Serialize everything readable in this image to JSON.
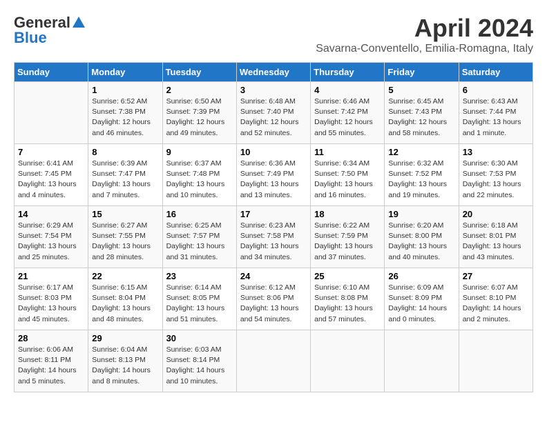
{
  "header": {
    "logo_general": "General",
    "logo_blue": "Blue",
    "month": "April 2024",
    "location": "Savarna-Conventello, Emilia-Romagna, Italy"
  },
  "days_of_week": [
    "Sunday",
    "Monday",
    "Tuesday",
    "Wednesday",
    "Thursday",
    "Friday",
    "Saturday"
  ],
  "weeks": [
    [
      {
        "day": "",
        "info": ""
      },
      {
        "day": "1",
        "info": "Sunrise: 6:52 AM\nSunset: 7:38 PM\nDaylight: 12 hours\nand 46 minutes."
      },
      {
        "day": "2",
        "info": "Sunrise: 6:50 AM\nSunset: 7:39 PM\nDaylight: 12 hours\nand 49 minutes."
      },
      {
        "day": "3",
        "info": "Sunrise: 6:48 AM\nSunset: 7:40 PM\nDaylight: 12 hours\nand 52 minutes."
      },
      {
        "day": "4",
        "info": "Sunrise: 6:46 AM\nSunset: 7:42 PM\nDaylight: 12 hours\nand 55 minutes."
      },
      {
        "day": "5",
        "info": "Sunrise: 6:45 AM\nSunset: 7:43 PM\nDaylight: 12 hours\nand 58 minutes."
      },
      {
        "day": "6",
        "info": "Sunrise: 6:43 AM\nSunset: 7:44 PM\nDaylight: 13 hours\nand 1 minute."
      }
    ],
    [
      {
        "day": "7",
        "info": "Sunrise: 6:41 AM\nSunset: 7:45 PM\nDaylight: 13 hours\nand 4 minutes."
      },
      {
        "day": "8",
        "info": "Sunrise: 6:39 AM\nSunset: 7:47 PM\nDaylight: 13 hours\nand 7 minutes."
      },
      {
        "day": "9",
        "info": "Sunrise: 6:37 AM\nSunset: 7:48 PM\nDaylight: 13 hours\nand 10 minutes."
      },
      {
        "day": "10",
        "info": "Sunrise: 6:36 AM\nSunset: 7:49 PM\nDaylight: 13 hours\nand 13 minutes."
      },
      {
        "day": "11",
        "info": "Sunrise: 6:34 AM\nSunset: 7:50 PM\nDaylight: 13 hours\nand 16 minutes."
      },
      {
        "day": "12",
        "info": "Sunrise: 6:32 AM\nSunset: 7:52 PM\nDaylight: 13 hours\nand 19 minutes."
      },
      {
        "day": "13",
        "info": "Sunrise: 6:30 AM\nSunset: 7:53 PM\nDaylight: 13 hours\nand 22 minutes."
      }
    ],
    [
      {
        "day": "14",
        "info": "Sunrise: 6:29 AM\nSunset: 7:54 PM\nDaylight: 13 hours\nand 25 minutes."
      },
      {
        "day": "15",
        "info": "Sunrise: 6:27 AM\nSunset: 7:55 PM\nDaylight: 13 hours\nand 28 minutes."
      },
      {
        "day": "16",
        "info": "Sunrise: 6:25 AM\nSunset: 7:57 PM\nDaylight: 13 hours\nand 31 minutes."
      },
      {
        "day": "17",
        "info": "Sunrise: 6:23 AM\nSunset: 7:58 PM\nDaylight: 13 hours\nand 34 minutes."
      },
      {
        "day": "18",
        "info": "Sunrise: 6:22 AM\nSunset: 7:59 PM\nDaylight: 13 hours\nand 37 minutes."
      },
      {
        "day": "19",
        "info": "Sunrise: 6:20 AM\nSunset: 8:00 PM\nDaylight: 13 hours\nand 40 minutes."
      },
      {
        "day": "20",
        "info": "Sunrise: 6:18 AM\nSunset: 8:01 PM\nDaylight: 13 hours\nand 43 minutes."
      }
    ],
    [
      {
        "day": "21",
        "info": "Sunrise: 6:17 AM\nSunset: 8:03 PM\nDaylight: 13 hours\nand 45 minutes."
      },
      {
        "day": "22",
        "info": "Sunrise: 6:15 AM\nSunset: 8:04 PM\nDaylight: 13 hours\nand 48 minutes."
      },
      {
        "day": "23",
        "info": "Sunrise: 6:14 AM\nSunset: 8:05 PM\nDaylight: 13 hours\nand 51 minutes."
      },
      {
        "day": "24",
        "info": "Sunrise: 6:12 AM\nSunset: 8:06 PM\nDaylight: 13 hours\nand 54 minutes."
      },
      {
        "day": "25",
        "info": "Sunrise: 6:10 AM\nSunset: 8:08 PM\nDaylight: 13 hours\nand 57 minutes."
      },
      {
        "day": "26",
        "info": "Sunrise: 6:09 AM\nSunset: 8:09 PM\nDaylight: 14 hours\nand 0 minutes."
      },
      {
        "day": "27",
        "info": "Sunrise: 6:07 AM\nSunset: 8:10 PM\nDaylight: 14 hours\nand 2 minutes."
      }
    ],
    [
      {
        "day": "28",
        "info": "Sunrise: 6:06 AM\nSunset: 8:11 PM\nDaylight: 14 hours\nand 5 minutes."
      },
      {
        "day": "29",
        "info": "Sunrise: 6:04 AM\nSunset: 8:13 PM\nDaylight: 14 hours\nand 8 minutes."
      },
      {
        "day": "30",
        "info": "Sunrise: 6:03 AM\nSunset: 8:14 PM\nDaylight: 14 hours\nand 10 minutes."
      },
      {
        "day": "",
        "info": ""
      },
      {
        "day": "",
        "info": ""
      },
      {
        "day": "",
        "info": ""
      },
      {
        "day": "",
        "info": ""
      }
    ]
  ]
}
